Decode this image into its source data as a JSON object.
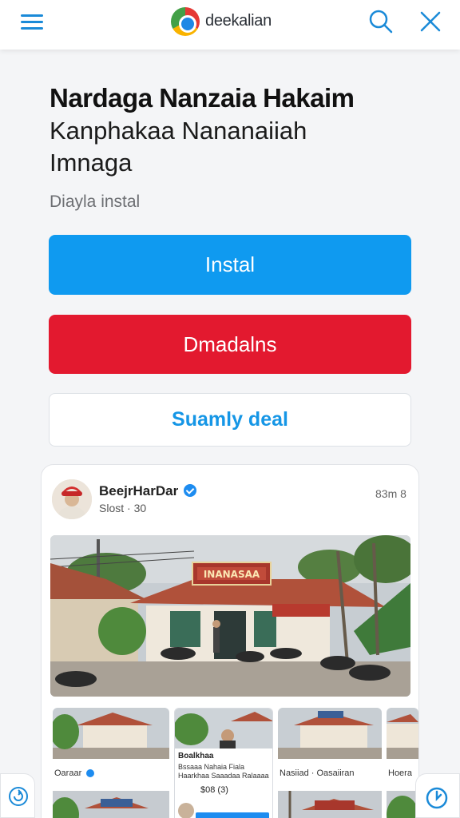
{
  "header": {
    "app_name": "deekalian",
    "menu_icon": "hamburger-menu-icon",
    "search_icon": "search-icon",
    "close_icon": "close-icon"
  },
  "main": {
    "title": "Nardaga Nanzaia Hakaim",
    "subtitle": "Kanphakaa Nananaiiah Imnaga",
    "caption": "Diayla instal"
  },
  "actions": {
    "install_label": "Instal",
    "download_label": "Dmadalns",
    "similar_label": "Suamly deal"
  },
  "post": {
    "author": "BeejrHarDar",
    "meta": "Slost · 30",
    "time": "83m 8",
    "sign_text": "INANASAA",
    "thumbs": [
      {
        "label": "Oaraar"
      },
      {
        "title": "Boalkhaa",
        "desc": "Bssaaa Nahaia Fiala Haarkhaa Saaadaa Ralaaaa",
        "num": "$08 (3)"
      },
      {
        "label": "Nasiiad · Oasaiiran"
      },
      {
        "label": "Hoera"
      }
    ]
  },
  "colors": {
    "primary": "#0f9af0",
    "danger": "#e3192f",
    "accent_text": "#1596e6"
  }
}
